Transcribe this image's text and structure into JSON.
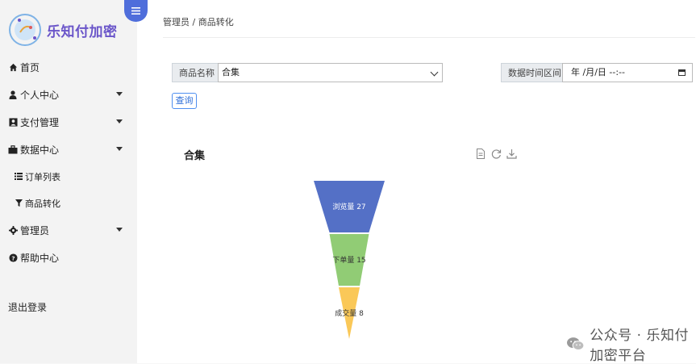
{
  "app": {
    "logo_text": "乐知付加密"
  },
  "sidebar": {
    "items": [
      {
        "label": "首页",
        "icon": "home-icon"
      },
      {
        "label": "个人中心",
        "icon": "user-icon",
        "has_caret": true
      },
      {
        "label": "支付管理",
        "icon": "payment-icon",
        "has_caret": true
      },
      {
        "label": "数据中心",
        "icon": "briefcase-icon",
        "has_caret": true,
        "children": [
          {
            "label": "订单列表",
            "icon": "list-icon"
          },
          {
            "label": "商品转化",
            "icon": "filter-icon"
          }
        ]
      },
      {
        "label": "管理员",
        "icon": "gear-icon",
        "has_caret": true
      },
      {
        "label": "帮助中心",
        "icon": "help-icon"
      }
    ],
    "logout": "退出登录"
  },
  "breadcrumb": "管理员 / 商品转化",
  "filters": {
    "product_label": "商品名称",
    "product_value": "合集",
    "date_label": "数据时间区间",
    "date_value": "年 /月/日 --:--",
    "query_button": "查询"
  },
  "colors": {
    "accent": "#4f6edb",
    "stage1": "#5470c6",
    "stage2": "#91cc75",
    "stage3": "#fac858"
  },
  "chart_data": {
    "type": "funnel",
    "title": "合集",
    "stages": [
      {
        "name": "浏览量",
        "value": 27,
        "label": "浏览量 27"
      },
      {
        "name": "下单量",
        "value": 15,
        "label": "下单量 15"
      },
      {
        "name": "成交量",
        "value": 8,
        "label": "成交量 8"
      }
    ]
  },
  "watermark": "公众号 · 乐知付加密平台"
}
